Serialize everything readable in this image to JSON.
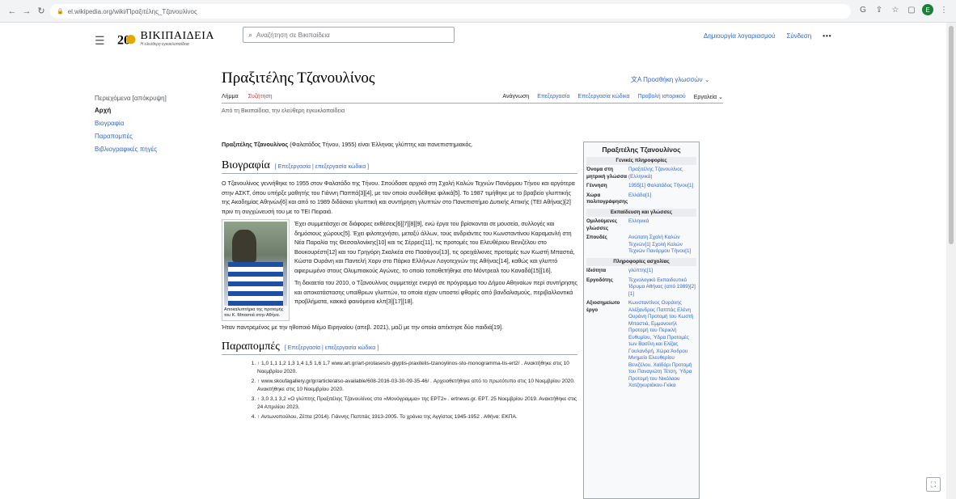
{
  "browser": {
    "url": "el.wikipedia.org/wiki/Πραξιτέλης_Τζανουλίνος",
    "profile_initial": "E"
  },
  "header": {
    "logo_title": "ΒΙΚΙΠΑΙΔΕΙΑ",
    "logo_subtitle": "Η ελεύθερη εγκυκλοπαίδεια",
    "search_placeholder": "Αναζήτηση σε Βικιπαίδεια",
    "create_account": "Δημιουργία λογαριασμού",
    "login": "Σύνδεση",
    "more": "•••"
  },
  "toc": {
    "heading": "Περιεχόμενα [απόκρυψη]",
    "items": [
      {
        "label": "Αρχή"
      },
      {
        "label": "Βιογραφία"
      },
      {
        "label": "Παραπομπές"
      },
      {
        "label": "Βιβλιογραφικές πηγές"
      }
    ]
  },
  "article": {
    "title": "Πραξιτέλης Τζανουλίνος",
    "add_languages": "Προσθήκη γλωσσών",
    "tab_article": "Λήμμα",
    "tab_talk": "Συζήτηση",
    "tab_read": "Ανάγνωση",
    "tab_edit": "Επεξεργασία",
    "tab_edit_source": "Επεξεργασία κώδικα",
    "tab_history": "Προβολή ιστορικού",
    "tab_tools": "Εργαλεία",
    "tagline": "Από τη Βικιπαίδεια, την ελεύθερη εγκυκλοπαίδεια",
    "intro_name": "Πραξιτέλης Τζανουλίνος",
    "intro_rest": " (Φαλατάδος Τήνου, 1955) είναι Έλληνας γλύπτης και πανεπιστημιακός.",
    "bio_heading": "Βιογραφία",
    "edit_links": "[ Επεξεργασία | επεξεργασία κώδικα ]",
    "bio_p1": "Ο Τζανουλίνος γεννήθηκε το 1955 στον Φαλατάδο της Τήνου. Σπούδασε αρχικά στη Σχολή Καλών Τεχνών Πανόρμου Τήνου και αργότερα στην ΑΣΚΤ, όπου υπήρξε μαθητής του Γιάννη Παππά[3][4], με τον οποίο συνδέθηκε φιλικά[5]. Το 1987 τιμήθηκε με το βραβείο γλυπτικής της Ακαδημίας Αθηνών[6] και από το 1989 διδάσκει γλυπτική και συντήρηση γλυπτών στο Πανεπιστήμιο Δυτικής Αττικής (ΤΕΙ Αθήνας)[2] πριν τη συγχώνευσή του με το ΤΕΙ Πειραιά.",
    "bio_p2": "Έχει συμμετάσχει σε διάφορες εκθέσεις[6][7][8][9], ενώ έργα του βρίσκονται σε μουσεία, συλλογές και δημόσιους χώρους[5]. Έχει φιλοτεχνήσει, μεταξύ άλλων, τους ανδριάντες του Κωνσταντίνου Καραμανλή στη Νέα Παραλία της Θεσσαλονίκης[10] και τις Σέρρες[11], τις προτομές του Ελευθέριου Βενιζέλου στο Βουκουρέστι[12] και του Γρηγόρη Σκαλκέα στο Πασάγου[13], τις ορειχάλκινες προτομές των Κωστή Μπαστιά, Κώστα Ουράνη και Παντελή Χορν στο Πάρκο Ελλήνων Λογοτεχνών της Αθήνας[14], καθώς και γλυπτό αφιερωμένο στους Ολυμπιακούς Αγώνες, το οποίο τοποθετήθηκε στο Μόντρεαλ του Καναδά[15][16].",
    "bio_p3": "Τη δεκαετία του 2010, ο Τζανουλίνος συμμετείχε ενεργά σε πρόγραμμα του Δήμου Αθηναίων περί συντήρησης και αποκατάστασης υπαίθριων γλυπτών, τα οποία είχαν υποστεί φθορές από βανδαλισμούς, περιβαλλοντικά προβλήματα, κακικά φαινόμενα κλπ[3][17][18].",
    "bio_p4": "Ήταν παντρεμένος με την ηθοποιό Μέμο Ειρηναίου (απεβ. 2021), μαζί με την οποία απέκτησε δύο παιδιά[19].",
    "photo_caption": "Αποκαλυπτήρια της προτομής του Κ. Μπαστιά στην Αθήνα.",
    "refs_heading": "Παραπομπές",
    "refs": [
      "↑ 1,0 1,1 1,2 1,3 1,4 1,5 1,6 1,7 www.art.gr/art-protases/o-glyptis-praxitelis-tzanoylinos-sto-monogramma-tis-ert2/ . Ανακτήθηκε στις 10 Νοεμβρίου 2020.",
      "↑ www.skoufagallery.gr/gr/article/also-available/608-2016-03-30-09-35-46/ . Αρχειοθετήθηκε από το πρωτότυπο στις 10 Νοεμβρίου 2020. Ανακτήθηκε στις 10 Νοεμβρίου 2020.",
      "↑ 3,0 3,1 3,2 «Ο γλύπτης Πραξιτέλης Τζανουλίνος στο «Μονόγραμμα» της ΕΡΤ2» . ertnews.gr. ΕΡΤ. 25 Νοεμβρίου 2019. Ανακτήθηκε στις 24 Απριλίου 2023.",
      "↑ Αντωνοπούλου, Ζέττα (2014). Γιάννης Παππάς 1913-2005. Το χρόνια της Αγγίστας 1945-1952 . Αθήνα: ΕΚΠΑ."
    ]
  },
  "infobox": {
    "title": "Πραξιτέλης Τζανουλίνος",
    "sec_general": "Γενικές πληροφορίες",
    "sec_education": "Εκπαίδευση και γλώσσες",
    "sec_work": "Πληροφορίες ασχολίας",
    "rows_general": [
      {
        "k": "Όνομα στη μητρική γλώσσα",
        "v": "Πραξιτέλης Τζανουλίνος (Ελληνικά)"
      },
      {
        "k": "Γέννηση",
        "v": "1955[1] Φαλατάδος Τήνου[1]"
      },
      {
        "k": "Χώρα πολιτογράφησης",
        "v": "Ελλάδα[1]"
      }
    ],
    "rows_education": [
      {
        "k": "Ομιλούμενες γλώσσες",
        "v": "Ελληνικά"
      },
      {
        "k": "Σπουδές",
        "v": "Ανώτατη Σχολή Καλών Τεχνών[1] Σχολή Καλών Τεχνών Πανόρμου Τήνου[1]"
      }
    ],
    "rows_work": [
      {
        "k": "Ιδιότητα",
        "v": "γλύπτης[1]"
      },
      {
        "k": "Εργοδότης",
        "v": "Τεχνολογικό Εκπαιδευτικό Ίδρυμα Αθήνας (από 1989)[2][1]"
      },
      {
        "k": "Αξιοσημείωτο έργο",
        "v": "Κωνσταντίνος Ουράνης Αλέξανδρος Παππάς Ελένη Ουράνη Προτομή του Κωστή Μπαστιά, Εμμανουήλ Προτομή του Περικλή Ευθυμίου, Ύδρα Προτομές των Βασίλη και Ελίζας Γουλανδρή, Χώρα Άνδρου Μνημείο Ελευθερίου Βενιζέλου, Χαϊδάρι Προτομή του Παναγιώτη Τέτση, Ύδρα Προτομή του Νικόλαου Χατζηκυριάκου-Γκίκα"
      }
    ]
  }
}
